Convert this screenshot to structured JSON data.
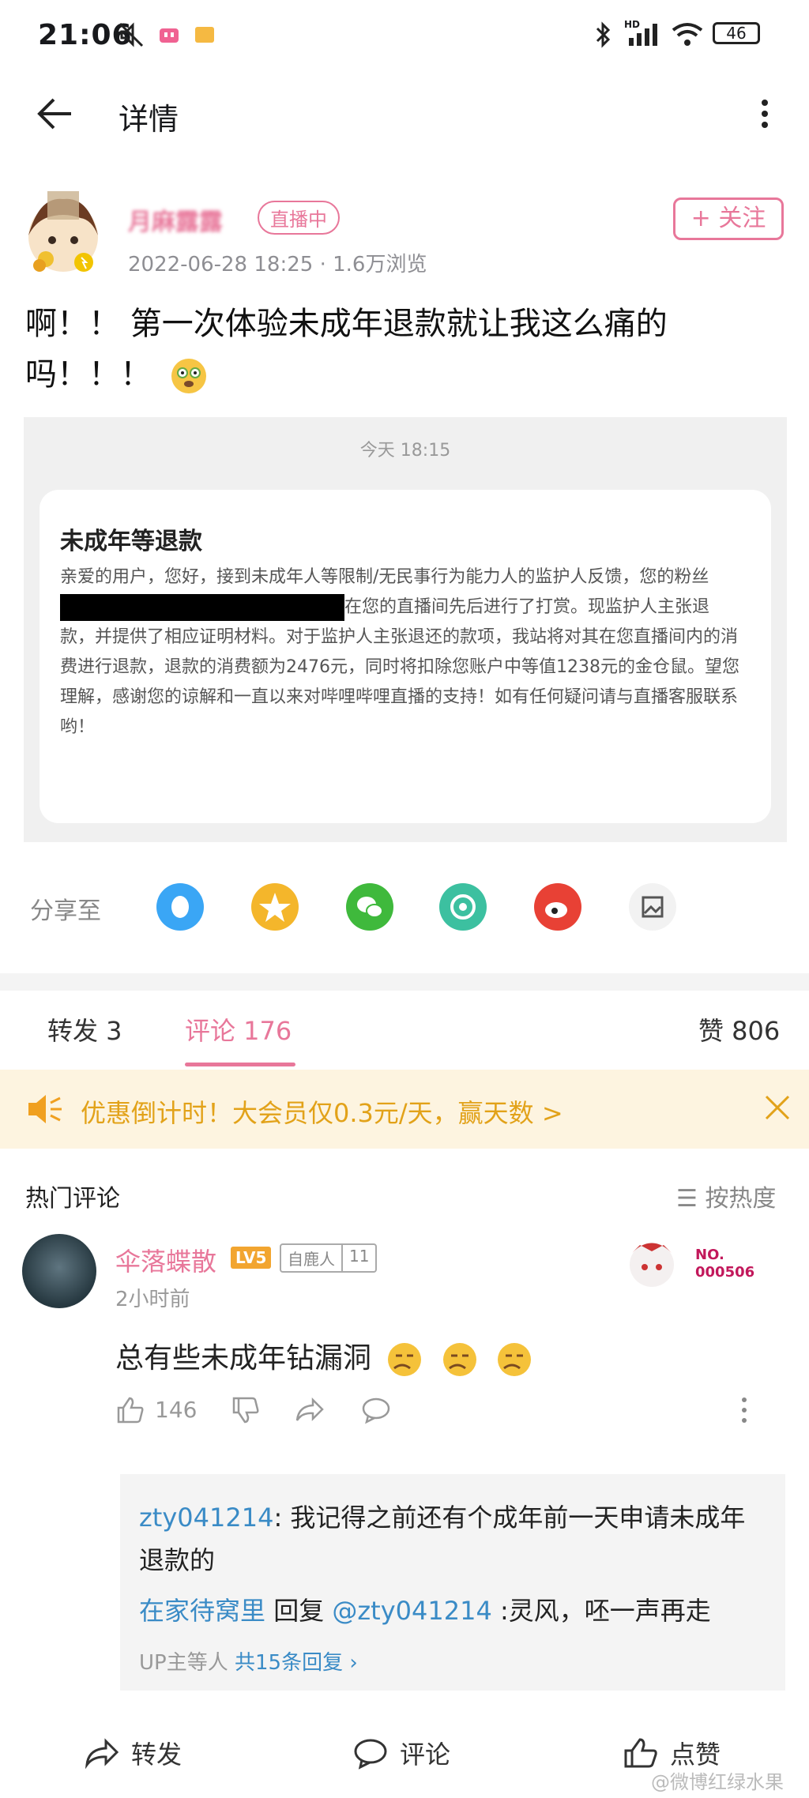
{
  "status_bar": {
    "time": "21:06",
    "battery": "46",
    "network": "HD"
  },
  "header": {
    "title": "详情"
  },
  "post": {
    "author": "月麻露露",
    "live_badge": "直播中",
    "follow_label": "+ 关注",
    "date": "2022-06-28 18:25",
    "views": "1.6万浏览",
    "meta_sep": "·",
    "text": "啊！！ 第一次体验未成年退款就让我这么痛的吗！！！"
  },
  "screenshot": {
    "time": "今天 18:15",
    "notice_title": "未成年等退款",
    "body_part1": "亲爱的用户，您好，接到未成年人等限制/无民事行为能力人的监护人反馈，您的粉丝",
    "body_part2": "在您的直播间先后进行了打赏。现监护人主张退款，并提供了相应证明材料。对于监护人主张退还的款项，我站将对其在您直播间内的消费进行退款，退款的消费额为2476元，同时将扣除您账户中等值1238元的金仓鼠。望您理解，感谢您的谅解和一直以来对哔哩哔哩直播的支持！如有任何疑问请与直播客服联系哟！"
  },
  "share": {
    "label": "分享至",
    "targets": [
      "qq",
      "qzone",
      "wechat",
      "moments",
      "weibo",
      "poster"
    ],
    "colors": [
      "#3aa6f5",
      "#f4b62b",
      "#3fb93c",
      "#3cc0a0",
      "#e84135",
      "#f2f2f2"
    ]
  },
  "tabs": {
    "repost": "转发 3",
    "comments": "评论 176",
    "likes": "赞 806"
  },
  "promo": {
    "text": "优惠倒计时！大会员仅0.3元/天，赢天数 >"
  },
  "hot": {
    "title": "热门评论",
    "sort": "按热度",
    "comment": {
      "user": "伞落蝶散",
      "level": "LV5",
      "fan_label": "自鹿人",
      "fan_level": "11",
      "time": "2小时前",
      "text": "总有些未成年钻漏洞",
      "likes": "146",
      "deco_text": "NO.\n000506"
    },
    "replies": {
      "r1_user": "zty041214",
      "r1_text": ": 我记得之前还有个成年前一天申请未成年退款的",
      "r2_user": "在家待窝里",
      "r2_reply": " 回复 ",
      "r2_target": "@zty041214",
      "r2_text": " :灵风，呸一声再走",
      "more_prefix": "UP主等人 ",
      "more_link": "共15条回复 ›"
    }
  },
  "bottom": {
    "repost": "转发",
    "comment": "评论",
    "like": "点赞"
  },
  "watermark": "@微博红绿水果"
}
